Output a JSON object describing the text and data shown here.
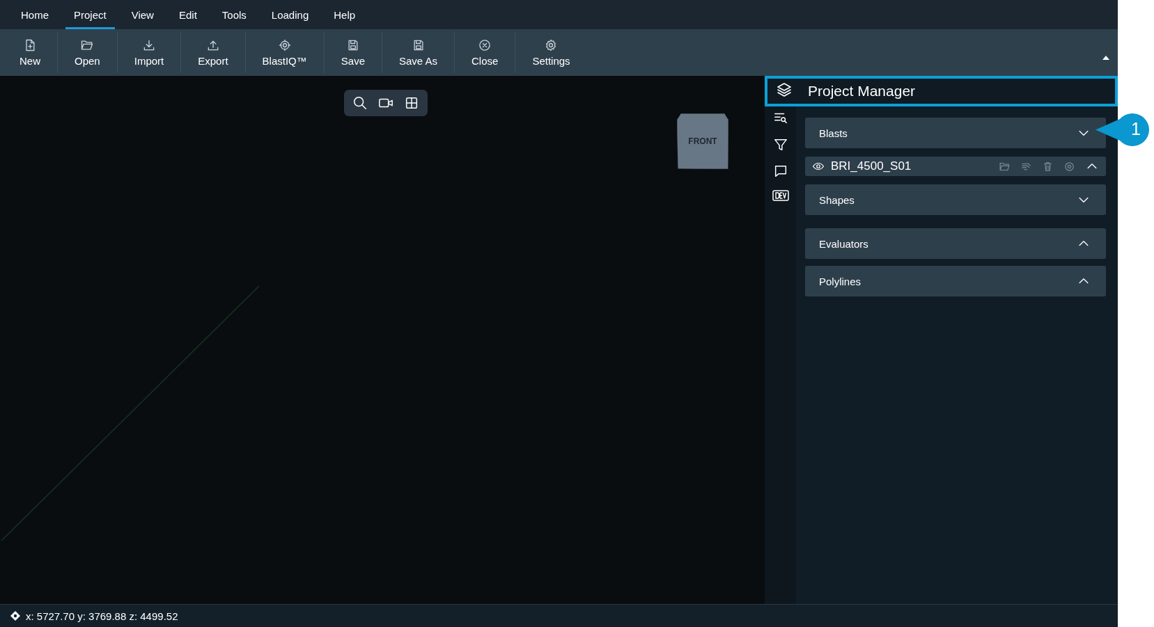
{
  "menu": [
    {
      "label": "Home",
      "selected": false
    },
    {
      "label": "Project",
      "selected": true
    },
    {
      "label": "View",
      "selected": false
    },
    {
      "label": "Edit",
      "selected": false
    },
    {
      "label": "Tools",
      "selected": false
    },
    {
      "label": "Loading",
      "selected": false
    },
    {
      "label": "Help",
      "selected": false
    }
  ],
  "toolbar": [
    "New",
    "Open",
    "Import",
    "Export",
    "BlastIQ™",
    "Save",
    "Save As",
    "Close",
    "Settings"
  ],
  "viewport": {
    "view_cube": "FRONT"
  },
  "panel": {
    "title": "Project Manager",
    "sections": [
      {
        "kind": "section",
        "label": "Blasts",
        "expanded": true
      },
      {
        "kind": "item",
        "label": "BRI_4500_S01",
        "expanded": false
      },
      {
        "kind": "section",
        "label": "Shapes",
        "expanded": true
      },
      {
        "kind": "section",
        "label": "Evaluators",
        "expanded": false
      },
      {
        "kind": "section",
        "label": "Polylines",
        "expanded": false
      }
    ],
    "callout": "1"
  },
  "status_bar": {
    "coordinates": "x: 5727.70 y: 3769.88 z: 4499.52"
  }
}
